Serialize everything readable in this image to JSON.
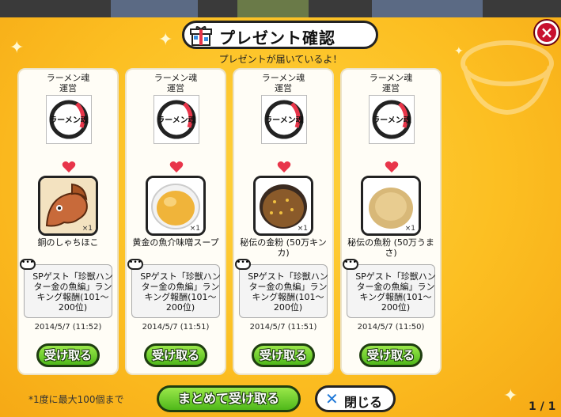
{
  "dialog": {
    "title": "プレゼント確認",
    "subtitle": "プレゼントが届いているよ！",
    "close_icon": "close-x-icon"
  },
  "cards": [
    {
      "sender": "ラーメン魂\n運営",
      "sender_logo_text": "ラーメン魂",
      "item_name": "銅のしゃちほこ",
      "item_icon": "bronze-shachihoko-icon",
      "quantity": "×1",
      "description": "SPゲスト「珍獣ハンター金の魚編」ランキング報酬(101～200位)",
      "date": "2014/5/7 (11:52)",
      "receive_label": "受け取る"
    },
    {
      "sender": "ラーメン魂\n運営",
      "sender_logo_text": "ラーメン魂",
      "item_name": "黄金の魚介味噌スープ",
      "item_icon": "golden-soup-icon",
      "quantity": "×1",
      "description": "SPゲスト「珍獣ハンター金の魚編」ランキング報酬(101～200位)",
      "date": "2014/5/7 (11:51)",
      "receive_label": "受け取る"
    },
    {
      "sender": "ラーメン魂\n運営",
      "sender_logo_text": "ラーメン魂",
      "item_name": "秘伝の金粉 (50万キンカ)",
      "item_icon": "secret-gold-powder-icon",
      "quantity": "×1",
      "description": "SPゲスト「珍獣ハンター金の魚編」ランキング報酬(101～200位)",
      "date": "2014/5/7 (11:51)",
      "receive_label": "受け取る"
    },
    {
      "sender": "ラーメン魂\n運営",
      "sender_logo_text": "ラーメン魂",
      "item_name": "秘伝の魚粉 (50万うまさ)",
      "item_icon": "secret-fish-powder-icon",
      "quantity": "×1",
      "description": "SPゲスト「珍獣ハンター金の魚編」ランキング報酬(101～200位)",
      "date": "2014/5/7 (11:50)",
      "receive_label": "受け取る"
    }
  ],
  "footer": {
    "limit_note": "*1度に最大100個まで",
    "bulk_receive_label": "まとめて受け取る",
    "close_label": "閉じる",
    "pager": "1 / 1"
  },
  "colors": {
    "background": "#fcbf22",
    "green_button": "#4fb81a",
    "close_red": "#c8102e",
    "heart": "#e8354a"
  }
}
